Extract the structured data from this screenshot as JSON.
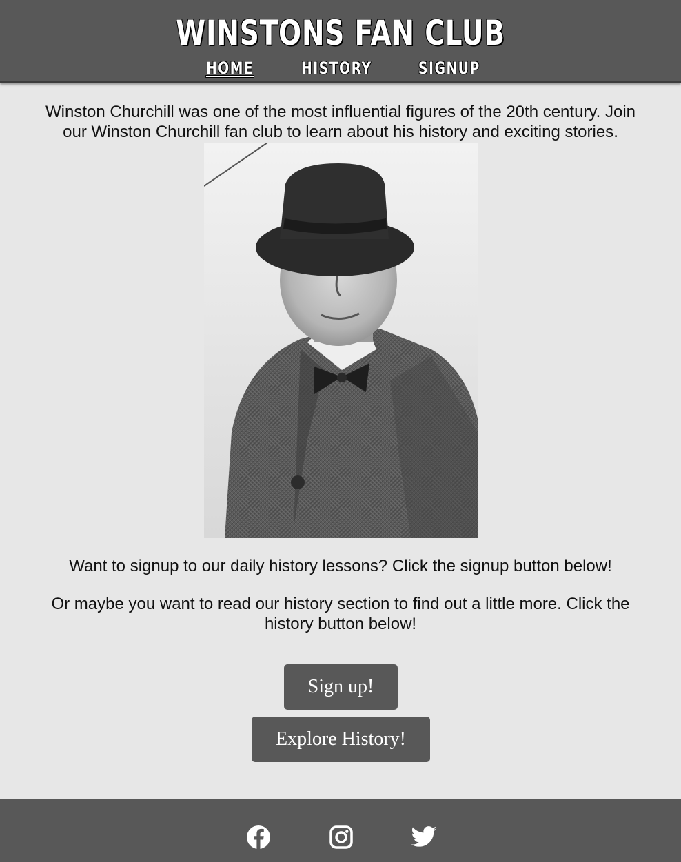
{
  "header": {
    "title": "WINSTONS FAN CLUB",
    "nav": [
      {
        "label": "HOME",
        "active": true
      },
      {
        "label": "HISTORY",
        "active": false
      },
      {
        "label": "SIGNUP",
        "active": false
      }
    ]
  },
  "main": {
    "intro": "Winston Churchill was one of the most influential figures of the 20th century. Join our Winston Churchill fan club to learn about his history and exciting stories.",
    "image_icon": "portrait-photo",
    "signup_text": "Want to signup to our daily history lessons? Click the signup button below!",
    "history_text": "Or maybe you want to read our history section to find out a little more. Click the history button below!",
    "signup_button": "Sign up!",
    "history_button": "Explore History!"
  },
  "footer": {
    "social": [
      "facebook-icon",
      "instagram-icon",
      "twitter-icon"
    ]
  },
  "colors": {
    "background": "#e7e7e7",
    "bar": "#585858",
    "button": "#585858",
    "text": "#111111"
  }
}
